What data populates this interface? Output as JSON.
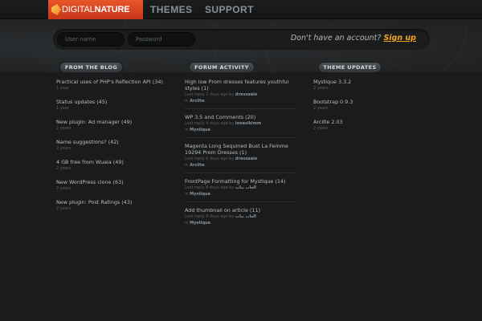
{
  "logo": {
    "part1": "DIGITAL",
    "part2": "NATURE"
  },
  "nav": {
    "themes": "THEMES",
    "support": "SUPPORT"
  },
  "login": {
    "username_placeholder": "User name",
    "password_placeholder": "Password",
    "prompt": "Don't have an account?",
    "signup": "Sign up"
  },
  "blog": {
    "header": "FROM THE BLOG",
    "items": [
      {
        "title": "Practical uses of PHP's Reflection API (34)",
        "meta": "1 year"
      },
      {
        "title": "Status updates (45)",
        "meta": "1 year"
      },
      {
        "title": "New plugin: Ad manager (49)",
        "meta": "2 years"
      },
      {
        "title": "Name suggestions? (42)",
        "meta": "2 years"
      },
      {
        "title": "4 GB free from Wuala (49)",
        "meta": "2 years"
      },
      {
        "title": "New WordPress clone (63)",
        "meta": "2 years"
      },
      {
        "title": "New plugin: Post Ratings (43)",
        "meta": "2 years"
      }
    ]
  },
  "forum": {
    "header": "FORUM ACTIVITY",
    "items": [
      {
        "title": "High low Prom dresses features youthful styles (1)",
        "last": "Last reply 2 days ago by",
        "user": "dressaaie",
        "in": "in",
        "forum": "Arclite"
      },
      {
        "title": "WP 3.5 and Comments (20)",
        "last": "Last reply 4 days ago by",
        "user": "lonesikimm",
        "in": "in",
        "forum": "Mystique"
      },
      {
        "title": "Magenta Long Sequined Bust La Femme 19294 Prom Dresses (1)",
        "last": "Last reply 6 days ago by",
        "user": "dressaaie",
        "in": "in",
        "forum": "Arclite"
      },
      {
        "title": "FrontPage Formatting for Mystique (14)",
        "last": "Last reply 8 days ago by",
        "user": "العاب بنات",
        "in": "in",
        "forum": "Mystique"
      },
      {
        "title": "Add thumbnail on article (11)",
        "last": "Last reply 8 days ago by",
        "user": "العاب بنات",
        "in": "in",
        "forum": "Mystique"
      }
    ]
  },
  "themes": {
    "header": "THEME UPDATES",
    "items": [
      {
        "title": "Mystique 3.3.2",
        "meta": "2 years"
      },
      {
        "title": "Bootstrap 0.9.3",
        "meta": "2 years"
      },
      {
        "title": "Arclite 2.03",
        "meta": "2 years"
      }
    ]
  }
}
